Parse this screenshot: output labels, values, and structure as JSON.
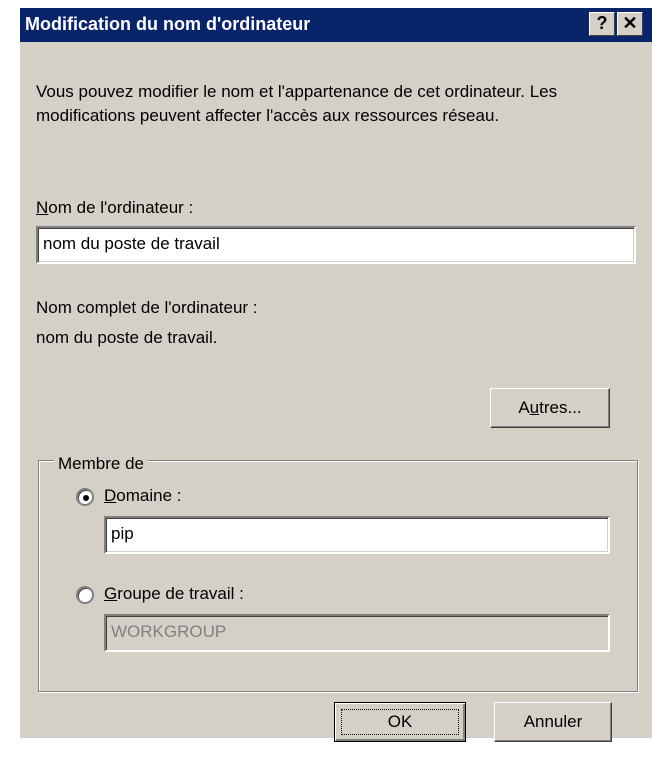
{
  "window": {
    "title": "Modification du nom d'ordinateur",
    "help_button": "?",
    "close_button": "✕"
  },
  "intro_text": "Vous pouvez modifier le nom et l'appartenance de cet ordinateur. Les modifications peuvent affecter l'accès aux ressources réseau.",
  "computer_name": {
    "label_first": "N",
    "label_rest": "om de l'ordinateur :",
    "value": "nom du poste de travail"
  },
  "full_name": {
    "label": "Nom complet de l'ordinateur :",
    "value": "nom du poste de travail."
  },
  "more_button": {
    "pre": "A",
    "mnemonic": "u",
    "post": "tres..."
  },
  "member_of": {
    "label": "Membre de",
    "domain": {
      "mnemonic": "D",
      "label_rest": "omaine :",
      "value": "pip",
      "selected": true
    },
    "workgroup": {
      "mnemonic": "G",
      "label_rest": "roupe de travail :",
      "value": "WORKGROUP",
      "selected": false
    }
  },
  "buttons": {
    "ok": "OK",
    "cancel": "Annuler"
  }
}
